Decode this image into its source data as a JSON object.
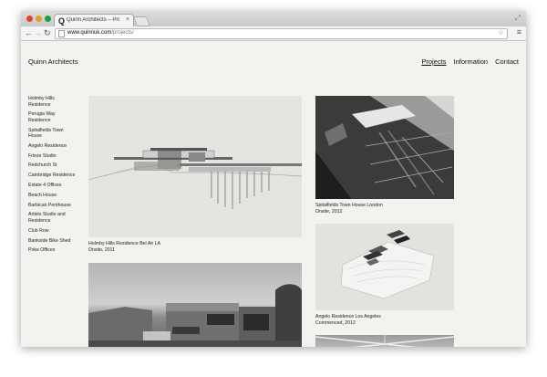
{
  "browser": {
    "tab_title": "Quinn Architects – Projects",
    "tab_close": "×",
    "favicon": "Q",
    "url_host": "www.quinnuk.com",
    "url_path": "/projects/"
  },
  "site": {
    "title": "Quinn Architects",
    "nav": [
      {
        "label": "Projects",
        "active": true
      },
      {
        "label": "Information",
        "active": false
      },
      {
        "label": "Contact",
        "active": false
      }
    ]
  },
  "sidebar": {
    "items": [
      "Holmby Hills Residence",
      "Perugia Way Residence",
      "Spitalfields Town House",
      "Angelo Residence",
      "Frieze Studio",
      "Redchurch St",
      "Cambridge Residence",
      "Estate 4 Offices",
      "Beach House",
      "Barbican Penthouse",
      "Artists Studio and Residence",
      "Club Row",
      "Bankside Bike Shed",
      "Poke Offices"
    ]
  },
  "projects": [
    {
      "title": "Holmby Hills Residence Bel Air LA",
      "status": "Onsite, 2011"
    },
    {
      "title": "Spitalfields Town House London",
      "status": "Onsite, 2012"
    },
    {
      "title": "Angelo Residence Los Angeles",
      "status": "Commenced, 2012"
    }
  ],
  "colors": {
    "page_background": "#f2f2ee",
    "text": "#111111"
  }
}
